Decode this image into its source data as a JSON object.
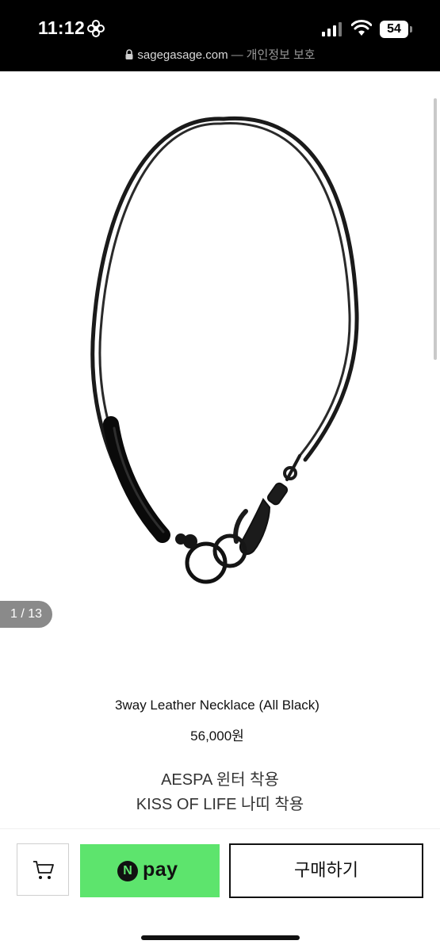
{
  "status_bar": {
    "time": "11:12",
    "battery": "54",
    "icons": [
      "flower-icon",
      "signal-icon",
      "wifi-icon",
      "battery-icon"
    ]
  },
  "browser": {
    "domain": "sagegasage.com",
    "separator": "—",
    "privacy_note": "개인정보 보호",
    "icon": "lock-icon"
  },
  "gallery": {
    "counter": "1 / 13"
  },
  "product": {
    "name": "3way Leather Necklace (All Black)",
    "price": "56,000원",
    "promo_lines": [
      "AESPA 윈터 착용",
      "KISS OF LIFE 나띠 착용"
    ]
  },
  "purchase_bar": {
    "cart_icon": "cart-icon",
    "npay_logo_letter": "N",
    "npay_label": "pay",
    "npay_color": "#5de46d",
    "buy_label": "구매하기"
  }
}
